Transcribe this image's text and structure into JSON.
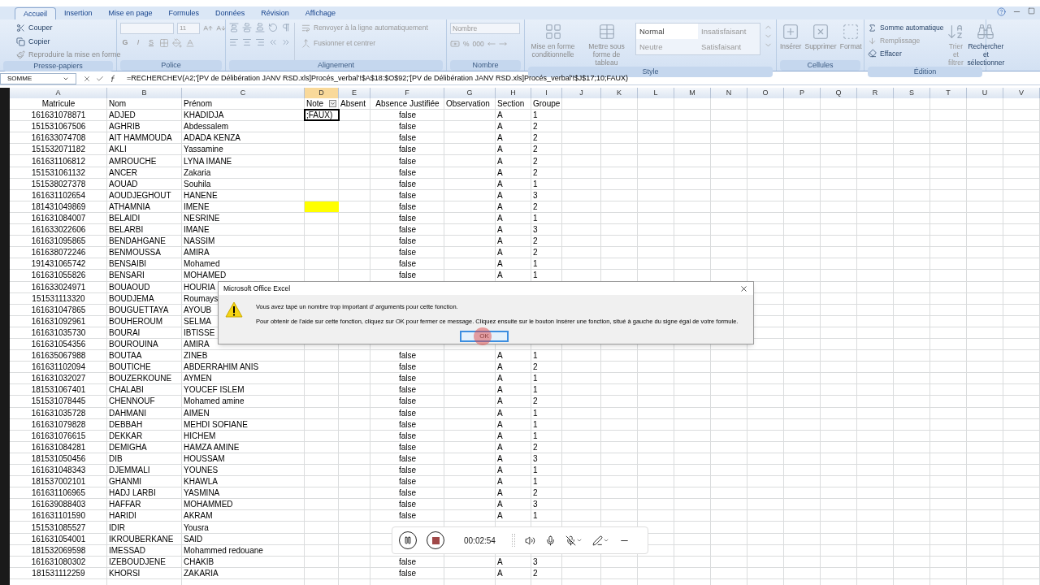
{
  "ribbon": {
    "tabs": [
      {
        "label": "Accueil",
        "selected": true
      },
      {
        "label": "Insertion",
        "selected": false
      },
      {
        "label": "Mise en page",
        "selected": false
      },
      {
        "label": "Formules",
        "selected": false
      },
      {
        "label": "Données",
        "selected": false
      },
      {
        "label": "Révision",
        "selected": false
      },
      {
        "label": "Affichage",
        "selected": false
      }
    ],
    "clipboard": {
      "label": "Presse-papiers",
      "cut": "Couper",
      "copy": "Copier",
      "format_painter": "Reproduire la mise en forme"
    },
    "font": {
      "label": "Police",
      "size": "11",
      "bold": "G",
      "italic": "I",
      "underline": "S"
    },
    "alignment": {
      "label": "Alignement",
      "wrap": "Renvoyer à la ligne automatiquement",
      "merge": "Fusionner et centrer"
    },
    "number": {
      "label": "Nombre",
      "format": "Nombre",
      "percent": "%",
      "thousands": "000"
    },
    "styles": {
      "label": "Style",
      "conditional": "Mise en forme conditionnelle",
      "table": "Mettre sous forme de tableau",
      "gallery": [
        {
          "label": "Normal",
          "selected": true
        },
        {
          "label": "Insatisfaisant",
          "selected": false
        },
        {
          "label": "Neutre",
          "selected": false
        },
        {
          "label": "Satisfaisant",
          "selected": false
        }
      ]
    },
    "cells": {
      "label": "Cellules",
      "buttons": [
        "Insérer",
        "Supprimer",
        "Format"
      ]
    },
    "editing": {
      "label": "Édition",
      "autosum": "Somme automatique",
      "fill": "Remplissage",
      "clear": "Effacer",
      "sort": "Trier et filtrer",
      "find": "Rechercher et sélectionner"
    }
  },
  "formula_bar": {
    "name_box": "SOMME",
    "formula": "=RECHERCHEV(A2;'[PV de Délibération JANV RSD.xls]Procés_verbal'!$A$18:$O$92;'[PV de Délibération JANV RSD.xls]Procés_verbal'!$J$17;10;FAUX)"
  },
  "column_letters": [
    {
      "label": "A",
      "selected": false
    },
    {
      "label": "B",
      "selected": false
    },
    {
      "label": "C",
      "selected": false
    },
    {
      "label": "D",
      "selected": true
    },
    {
      "label": "E",
      "selected": false
    },
    {
      "label": "F",
      "selected": false
    },
    {
      "label": "G",
      "selected": false
    },
    {
      "label": "H",
      "selected": false
    },
    {
      "label": "I",
      "selected": false
    },
    {
      "label": "J",
      "selected": false
    },
    {
      "label": "K",
      "selected": false
    },
    {
      "label": "L",
      "selected": false
    },
    {
      "label": "M",
      "selected": false
    },
    {
      "label": "N",
      "selected": false
    },
    {
      "label": "O",
      "selected": false
    },
    {
      "label": "P",
      "selected": false
    },
    {
      "label": "Q",
      "selected": false
    },
    {
      "label": "R",
      "selected": false
    },
    {
      "label": "S",
      "selected": false
    },
    {
      "label": "T",
      "selected": false
    },
    {
      "label": "U",
      "selected": false
    },
    {
      "label": "V",
      "selected": false
    }
  ],
  "headers": [
    "Matricule",
    "Nom",
    "Prénom",
    "Note",
    "Absent",
    "Absence Justifiée",
    "Observation",
    "Section",
    "Groupe"
  ],
  "rows": [
    {
      "matricule": "161631078871",
      "nom": "ADJED",
      "prenom": "KHADIDJA",
      "note_cell": {
        "kind": "editing",
        "text": ";FAUX)"
      },
      "absence_justifiee": "false",
      "section": "A",
      "groupe": "1"
    },
    {
      "matricule": "151531067506",
      "nom": "AGHRIB",
      "prenom": "Abdessalem",
      "absence_justifiee": "false",
      "section": "A",
      "groupe": "2"
    },
    {
      "matricule": "161633074708",
      "nom": "AIT HAMMOUDA",
      "prenom": "ADADA KENZA",
      "absence_justifiee": "false",
      "section": "A",
      "groupe": "2"
    },
    {
      "matricule": "151532071182",
      "nom": "AKLI",
      "prenom": "Yassamine",
      "absence_justifiee": "false",
      "section": "A",
      "groupe": "2"
    },
    {
      "matricule": "161631106812",
      "nom": "AMROUCHE",
      "prenom": "LYNA IMANE",
      "absence_justifiee": "false",
      "section": "A",
      "groupe": "2"
    },
    {
      "matricule": "151531061132",
      "nom": "ANCER",
      "prenom": "Zakaria",
      "absence_justifiee": "false",
      "section": "A",
      "groupe": "2"
    },
    {
      "matricule": "151538027378",
      "nom": "AOUAD",
      "prenom": "Souhila",
      "absence_justifiee": "false",
      "section": "A",
      "groupe": "1"
    },
    {
      "matricule": "161631102654",
      "nom": "AOUDJEGHOUT",
      "prenom": "HANENE",
      "absence_justifiee": "false",
      "section": "A",
      "groupe": "3"
    },
    {
      "matricule": "181431049869",
      "nom": "ATHAMNIA",
      "prenom": "IMENE",
      "note_cell": {
        "kind": "highlighted"
      },
      "absence_justifiee": "false",
      "section": "A",
      "groupe": "2"
    },
    {
      "matricule": "161631084007",
      "nom": "BELAIDI",
      "prenom": "NESRINE",
      "absence_justifiee": "false",
      "section": "A",
      "groupe": "1"
    },
    {
      "matricule": "161633022606",
      "nom": "BELARBI",
      "prenom": "IMANE",
      "absence_justifiee": "false",
      "section": "A",
      "groupe": "3"
    },
    {
      "matricule": "161631095865",
      "nom": "BENDAHGANE",
      "prenom": "NASSIM",
      "absence_justifiee": "false",
      "section": "A",
      "groupe": "2"
    },
    {
      "matricule": "161638072246",
      "nom": "BENMOUSSA",
      "prenom": "AMIRA",
      "absence_justifiee": "false",
      "section": "A",
      "groupe": "2"
    },
    {
      "matricule": "191431065742",
      "nom": "BENSAIBI",
      "prenom": "Mohamed",
      "absence_justifiee": "false",
      "section": "A",
      "groupe": "1"
    },
    {
      "matricule": "161631055826",
      "nom": "BENSARI",
      "prenom": "MOHAMED",
      "absence_justifiee": "false",
      "section": "A",
      "groupe": "1"
    },
    {
      "matricule": "161633024971",
      "nom": "BOUAOUD",
      "prenom": "HOURIA"
    },
    {
      "matricule": "151531113320",
      "nom": "BOUDJEMA",
      "prenom": "Roumays"
    },
    {
      "matricule": "161631047865",
      "nom": "BOUGUETTAYA",
      "prenom": "AYOUB"
    },
    {
      "matricule": "161631092961",
      "nom": "BOUHEROUM",
      "prenom": "SELMA"
    },
    {
      "matricule": "161631035730",
      "nom": "BOURAI",
      "prenom": "IBTISSE"
    },
    {
      "matricule": "161631054356",
      "nom": "BOUROUINA",
      "prenom": "AMIRA"
    },
    {
      "matricule": "161635067988",
      "nom": "BOUTAA",
      "prenom": "ZINEB",
      "absence_justifiee": "false",
      "section": "A",
      "groupe": "1"
    },
    {
      "matricule": "161631102094",
      "nom": "BOUTICHE",
      "prenom": "ABDERRAHIM ANIS",
      "absence_justifiee": "false",
      "section": "A",
      "groupe": "2"
    },
    {
      "matricule": "161631032027",
      "nom": "BOUZERKOUNE",
      "prenom": "AYMEN",
      "absence_justifiee": "false",
      "section": "A",
      "groupe": "1"
    },
    {
      "matricule": "181531067401",
      "nom": "CHALABI",
      "prenom": "YOUCEF ISLEM",
      "absence_justifiee": "false",
      "section": "A",
      "groupe": "1"
    },
    {
      "matricule": "151531078445",
      "nom": "CHENNOUF",
      "prenom": "Mohamed amine",
      "absence_justifiee": "false",
      "section": "A",
      "groupe": "2"
    },
    {
      "matricule": "161631035728",
      "nom": "DAHMANI",
      "prenom": "AIMEN",
      "absence_justifiee": "false",
      "section": "A",
      "groupe": "1"
    },
    {
      "matricule": "161631079828",
      "nom": "DEBBAH",
      "prenom": "MEHDI SOFIANE",
      "absence_justifiee": "false",
      "section": "A",
      "groupe": "1"
    },
    {
      "matricule": "161631076615",
      "nom": "DEKKAR",
      "prenom": "HICHEM",
      "absence_justifiee": "false",
      "section": "A",
      "groupe": "1"
    },
    {
      "matricule": "161631084281",
      "nom": "DEMIGHA",
      "prenom": "HAMZA AMINE",
      "absence_justifiee": "false",
      "section": "A",
      "groupe": "2"
    },
    {
      "matricule": "181531050456",
      "nom": "DIB",
      "prenom": "HOUSSAM",
      "absence_justifiee": "false",
      "section": "A",
      "groupe": "3"
    },
    {
      "matricule": "161631048343",
      "nom": "DJEMMALI",
      "prenom": "YOUNES",
      "absence_justifiee": "false",
      "section": "A",
      "groupe": "1"
    },
    {
      "matricule": "181537002101",
      "nom": "GHANMI",
      "prenom": "KHAWLA",
      "absence_justifiee": "false",
      "section": "A",
      "groupe": "1"
    },
    {
      "matricule": "161631106965",
      "nom": "HADJ LARBI",
      "prenom": "YASMINA",
      "absence_justifiee": "false",
      "section": "A",
      "groupe": "2"
    },
    {
      "matricule": "161639088403",
      "nom": "HAFFAR",
      "prenom": "MOHAMMED",
      "absence_justifiee": "false",
      "section": "A",
      "groupe": "3"
    },
    {
      "matricule": "161631101590",
      "nom": "HARIDI",
      "prenom": "AKRAM",
      "absence_justifiee": "false",
      "section": "A",
      "groupe": "1"
    },
    {
      "matricule": "151531085527",
      "nom": "IDIR",
      "prenom": "Yousra"
    },
    {
      "matricule": "161631054001",
      "nom": "IKROUBERKANE",
      "prenom": "SAID"
    },
    {
      "matricule": "181532069598",
      "nom": "IMESSAD",
      "prenom": "Mohammed redouane"
    },
    {
      "matricule": "161631080302",
      "nom": "IZEBOUDJENE",
      "prenom": "CHAKIB",
      "absence_justifiee": "false",
      "section": "A",
      "groupe": "3"
    },
    {
      "matricule": "181531112259",
      "nom": "KHORSI",
      "prenom": "ZAKARIA",
      "absence_justifiee": "false",
      "section": "A",
      "groupe": "2"
    }
  ],
  "dialog": {
    "title": "Microsoft Office Excel",
    "lines": [
      "Vous avez tapé un nombre trop important d' arguments pour cette fonction.",
      "Pour obtenir de l'aide sur cette fonction, cliquez sur OK pour fermer ce message. Cliquez ensuite sur le bouton Insérer une fonction, situé à gauche du signe égal de votre formule."
    ],
    "ok": "OK"
  },
  "recorder": {
    "time": "00:02:54"
  }
}
